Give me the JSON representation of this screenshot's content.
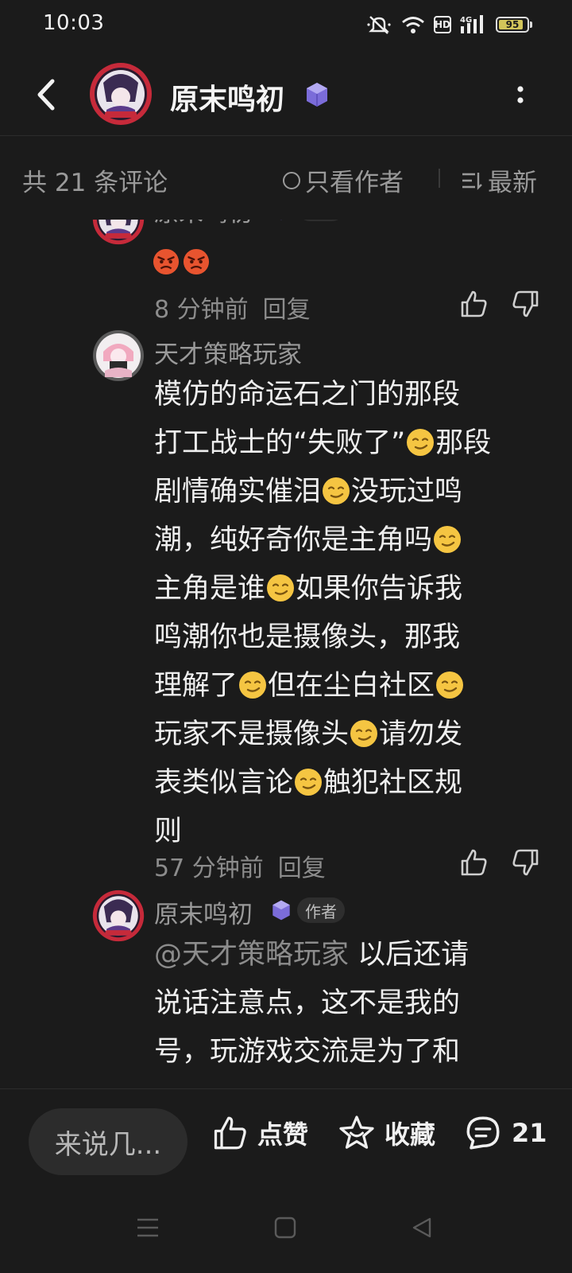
{
  "status": {
    "time": "10:03",
    "hd": "HD",
    "network": "4G",
    "battery": "95"
  },
  "header": {
    "title": "原末鸣初"
  },
  "filters": {
    "count_label": "共 21 条评论",
    "only_author": "只看作者",
    "sort": "最新"
  },
  "comments": [
    {
      "username": "原末鸣初",
      "author_tag": "作者",
      "emojis": [
        "angry-face",
        "angry-face"
      ],
      "time": "8 分钟前",
      "reply": "回复"
    },
    {
      "username": "天才策略玩家",
      "lines": [
        "模仿的命运石之门的那段",
        "打工战士的“失败了”",
        "那段",
        "剧情确实催泪",
        "没玩过鸣",
        "潮，纯好奇你是主角吗",
        "主角是谁",
        "如果你告诉我",
        "鸣潮你也是摄像头，那我",
        "理解了",
        "但在尘白社区",
        "玩家不是摄像头",
        "请勿发",
        "表类似言论",
        "触犯社区规",
        "则"
      ],
      "time": "57 分钟前",
      "reply": "回复"
    },
    {
      "username": "原末鸣初",
      "author_tag": "作者",
      "mention": "@天才策略玩家",
      "lines": [
        " 以后还请",
        "说话注意点，这不是我的",
        "号，玩游戏交流是为了和"
      ]
    }
  ],
  "bottom": {
    "input_placeholder": "来说几...",
    "like": "点赞",
    "favorite": "收藏",
    "comment_count": "21"
  },
  "icons": {
    "back": "back-arrow-icon",
    "more": "more-vertical-icon",
    "badge": "level-cube-icon",
    "like": "thumb-up-icon",
    "dislike": "thumb-down-icon",
    "star": "star-icon",
    "comment": "comment-bubble-icon",
    "emoji": "smirk-face-emoji"
  },
  "colors": {
    "background": "#1b1b1b",
    "text": "#e8e8e8",
    "muted": "#9a9a9a",
    "emoji": "#f5c542",
    "badge": "#7b6cd9"
  }
}
